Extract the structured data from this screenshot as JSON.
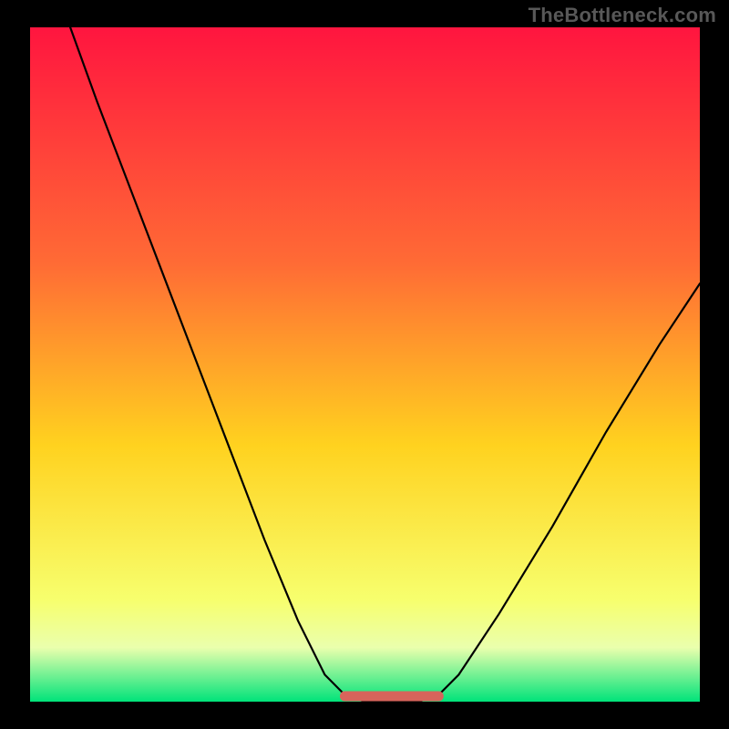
{
  "watermark": "TheBottleneck.com",
  "colors": {
    "frame": "#000000",
    "curve": "#000000",
    "flat_accent": "#d7645b",
    "grad_top": "#ff153f",
    "grad_mid_upper": "#ff6b35",
    "grad_mid": "#ffd21f",
    "grad_lower": "#f7ff6e",
    "grad_band_light": "#eaffad",
    "grad_bottom": "#00e37a"
  },
  "chart_data": {
    "type": "line",
    "title": "",
    "xlabel": "",
    "ylabel": "",
    "xlim": [
      0,
      100
    ],
    "ylim": [
      0,
      100
    ],
    "curve": [
      {
        "x": 6,
        "y": 100
      },
      {
        "x": 10,
        "y": 89
      },
      {
        "x": 15,
        "y": 76
      },
      {
        "x": 20,
        "y": 63
      },
      {
        "x": 25,
        "y": 50
      },
      {
        "x": 30,
        "y": 37
      },
      {
        "x": 35,
        "y": 24
      },
      {
        "x": 40,
        "y": 12
      },
      {
        "x": 44,
        "y": 4
      },
      {
        "x": 47,
        "y": 1
      },
      {
        "x": 50,
        "y": 0
      },
      {
        "x": 55,
        "y": 0
      },
      {
        "x": 58,
        "y": 0
      },
      {
        "x": 61,
        "y": 1
      },
      {
        "x": 64,
        "y": 4
      },
      {
        "x": 70,
        "y": 13
      },
      {
        "x": 78,
        "y": 26
      },
      {
        "x": 86,
        "y": 40
      },
      {
        "x": 94,
        "y": 53
      },
      {
        "x": 100,
        "y": 62
      }
    ],
    "flat_region": {
      "x_start": 47,
      "x_end": 61,
      "y": 0
    },
    "gradient_stops": [
      {
        "offset": 0,
        "color_key": "grad_top"
      },
      {
        "offset": 35,
        "color_key": "grad_mid_upper"
      },
      {
        "offset": 62,
        "color_key": "grad_mid"
      },
      {
        "offset": 85,
        "color_key": "grad_lower"
      },
      {
        "offset": 92,
        "color_key": "grad_band_light"
      },
      {
        "offset": 100,
        "color_key": "grad_bottom"
      }
    ]
  }
}
